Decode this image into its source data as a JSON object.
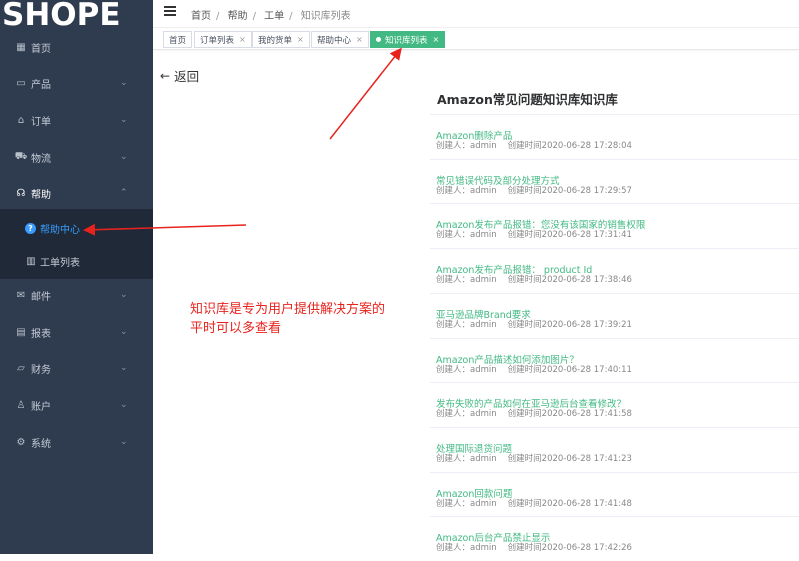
{
  "logo": "SHOPE",
  "sidebar": {
    "items": [
      {
        "label": "首页",
        "icon": "dashboard-icon",
        "glyph": "▦",
        "chevron": false
      },
      {
        "label": "产品",
        "icon": "box-icon",
        "glyph": "▭",
        "chevron": true
      },
      {
        "label": "订单",
        "icon": "bag-icon",
        "glyph": "⌂",
        "chevron": true
      },
      {
        "label": "物流",
        "icon": "truck-icon",
        "glyph": "⛟",
        "chevron": true
      },
      {
        "label": "帮助",
        "icon": "headset-icon",
        "glyph": "☊",
        "chevron": true,
        "open": true
      },
      {
        "label": "邮件",
        "icon": "mail-icon",
        "glyph": "✉",
        "chevron": true
      },
      {
        "label": "报表",
        "icon": "report-icon",
        "glyph": "▤",
        "chevron": true
      },
      {
        "label": "财务",
        "icon": "folder-icon",
        "glyph": "▱",
        "chevron": true
      },
      {
        "label": "账户",
        "icon": "user-icon",
        "glyph": "♙",
        "chevron": true
      },
      {
        "label": "系统",
        "icon": "gear-icon",
        "glyph": "⚙",
        "chevron": true
      }
    ],
    "submenu": [
      {
        "label": "帮助中心",
        "icon": "question-icon",
        "glyph": "?",
        "active": true
      },
      {
        "label": "工单列表",
        "icon": "ticket-icon",
        "glyph": "▥",
        "active": false
      }
    ]
  },
  "breadcrumb": [
    "首页",
    "帮助",
    "工单",
    "知识库列表"
  ],
  "tabs": [
    {
      "label": "首页",
      "closable": false
    },
    {
      "label": "订单列表",
      "closable": true
    },
    {
      "label": "我的货单",
      "closable": true
    },
    {
      "label": "帮助中心",
      "closable": true
    },
    {
      "label": "知识库列表",
      "closable": true,
      "active": true
    }
  ],
  "back_label": "返回",
  "kb": {
    "title": "Amazon常见问题知识库知识库",
    "creator_prefix": "创建人：",
    "time_prefix": "创建时间",
    "items": [
      {
        "title": "Amazon删除产品",
        "creator": "admin",
        "time": "2020-06-28 17:28:04"
      },
      {
        "title": "常见错误代码及部分处理方式",
        "creator": "admin",
        "time": "2020-06-28 17:29:57"
      },
      {
        "title": "Amazon发布产品报错：您没有该国家的销售权限",
        "creator": "admin",
        "time": "2020-06-28 17:31:41"
      },
      {
        "title": "Amazon发布产品报错： product Id",
        "creator": "admin",
        "time": "2020-06-28 17:38:46"
      },
      {
        "title": "亚马逊品牌Brand要求",
        "creator": "admin",
        "time": "2020-06-28 17:39:21"
      },
      {
        "title": "Amazon产品描述如何添加图片？",
        "creator": "admin",
        "time": "2020-06-28 17:40:11"
      },
      {
        "title": "发布失败的产品如何在亚马逊后台查看修改？",
        "creator": "admin",
        "time": "2020-06-28 17:41:58"
      },
      {
        "title": "处理国际退货问题",
        "creator": "admin",
        "time": "2020-06-28 17:41:23"
      },
      {
        "title": "Amazon回款问题",
        "creator": "admin",
        "time": "2020-06-28 17:41:48"
      },
      {
        "title": "Amazon后台产品禁止显示",
        "creator": "admin",
        "time": "2020-06-28 17:42:26"
      }
    ]
  },
  "annotation": {
    "line1": "知识库是专为用户提供解决方案的",
    "line2": "平时可以多查看"
  },
  "colors": {
    "sidebar_bg": "#2f3c4f",
    "submenu_bg": "#1f2937",
    "accent_green": "#42b983",
    "active_blue": "#3a9cff",
    "annotation_red": "#e8231d"
  }
}
